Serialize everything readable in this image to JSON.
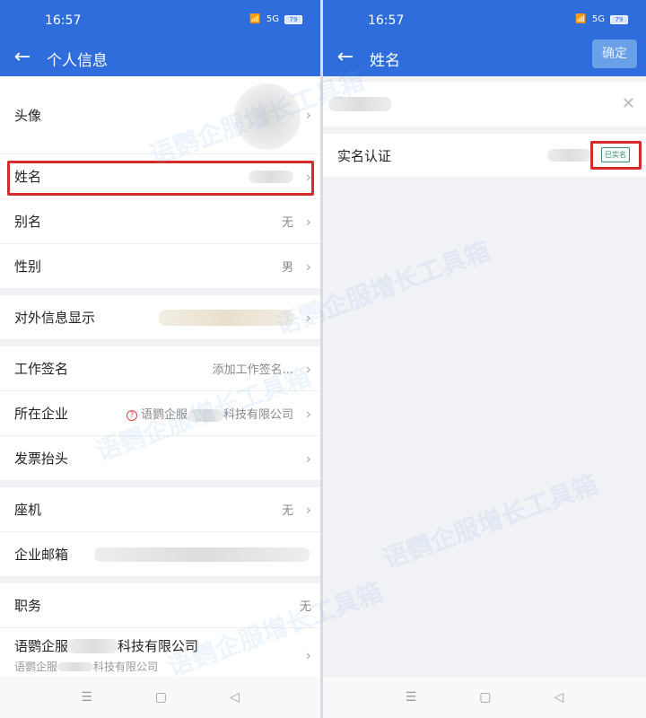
{
  "status": {
    "time": "16:57",
    "battery": "79",
    "network": "5G"
  },
  "left": {
    "title": "个人信息",
    "rows": {
      "avatar": "头像",
      "name": "姓名",
      "alias": {
        "label": "别名",
        "value": "无"
      },
      "gender": {
        "label": "性别",
        "value": "男"
      },
      "external": "对外信息显示",
      "signature": {
        "label": "工作签名",
        "value": "添加工作签名..."
      },
      "company": {
        "label": "所在企业",
        "value_prefix": "语鹦企服",
        "value_suffix": "科技有限公司"
      },
      "invoice": "发票抬头",
      "landline": {
        "label": "座机",
        "value": "无"
      },
      "email": "企业邮箱",
      "position": {
        "label": "职务",
        "value": "无"
      },
      "org": {
        "title_prefix": "语鹦企服",
        "title_suffix": "科技有限公司",
        "sub_prefix": "语鹦企服",
        "sub_suffix": "科技有限公司"
      }
    }
  },
  "right": {
    "title": "姓名",
    "confirm": "确定",
    "verify_label": "实名认证",
    "verify_badge": "已实名"
  },
  "watermark": "语鹦企服增长工具箱",
  "nav": {
    "menu": "☰",
    "home": "▢",
    "back": "◁"
  },
  "colors": {
    "primary": "#2f6ddd",
    "highlight": "#d52b2b",
    "badge": "#3b8c6a"
  },
  "icons": [
    "back-arrow-icon",
    "chevron-right-icon",
    "question-icon",
    "clear-icon",
    "menu-icon",
    "home-icon",
    "back-icon"
  ]
}
